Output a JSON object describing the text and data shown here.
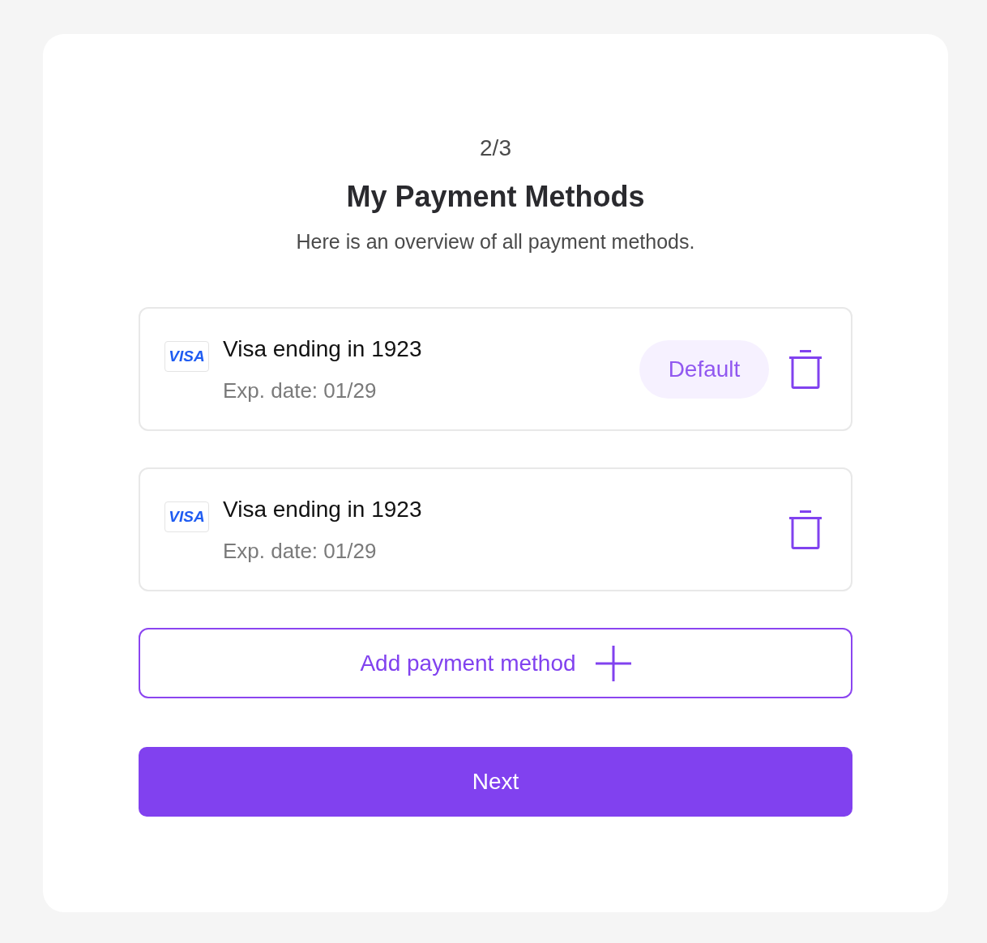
{
  "step": "2/3",
  "title": "My Payment Methods",
  "subtitle": "Here is an overview of all payment methods.",
  "payment_methods": [
    {
      "logo": "VISA",
      "name": "Visa ending in 1923",
      "expiry": "Exp. date: 01/29",
      "badge": "Default"
    },
    {
      "logo": "VISA",
      "name": "Visa ending in 1923",
      "expiry": "Exp. date: 01/29"
    }
  ],
  "add_button": {
    "label": "Add payment method"
  },
  "next_button": {
    "label": "Next"
  }
}
